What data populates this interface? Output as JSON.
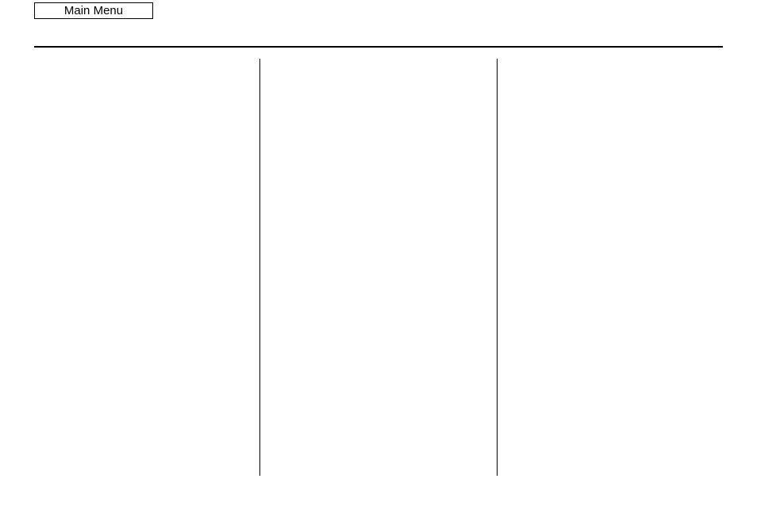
{
  "header": {
    "main_menu_label": "Main Menu"
  }
}
